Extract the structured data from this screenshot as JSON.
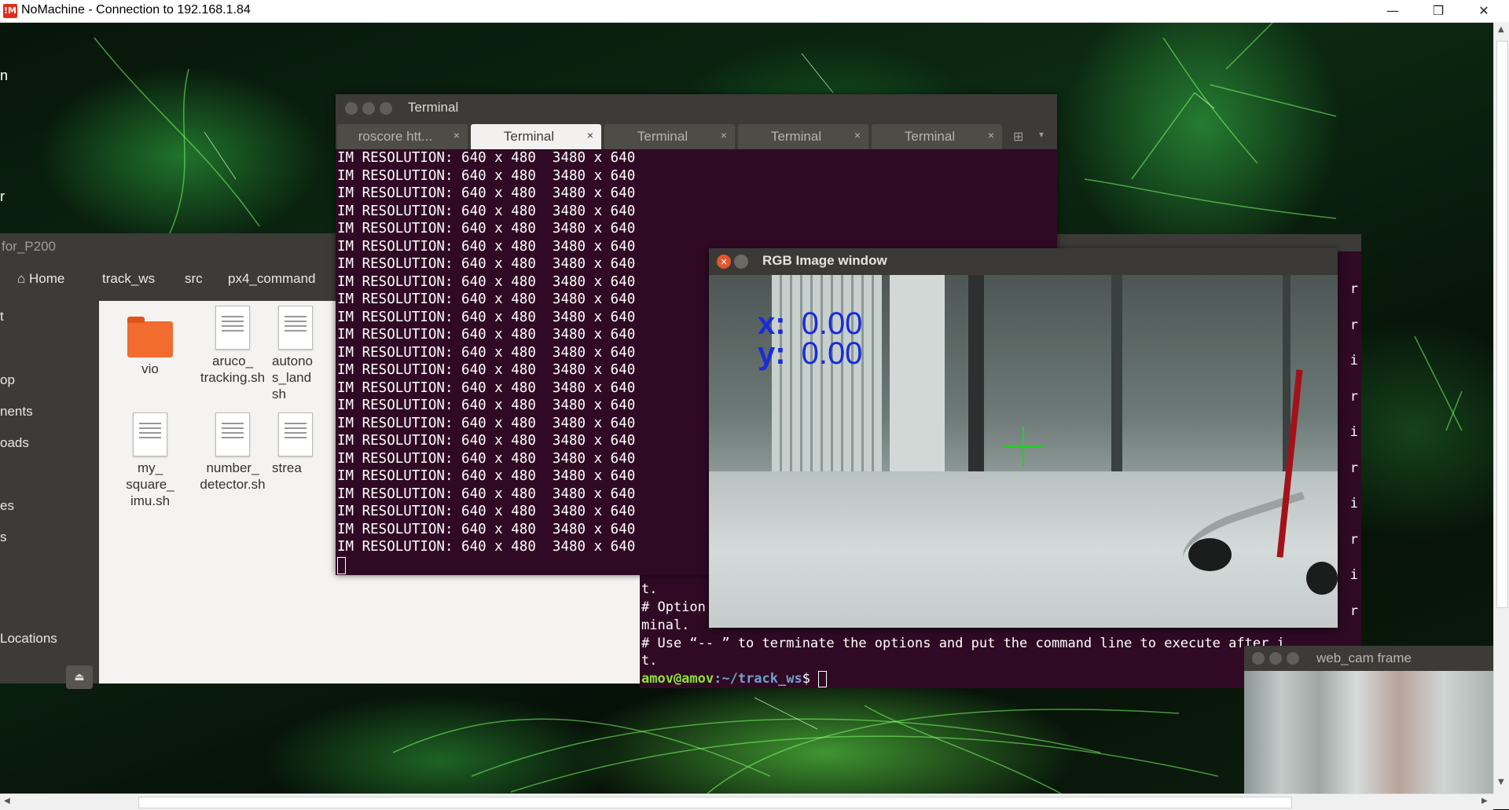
{
  "host_window": {
    "title": "NoMachine - Connection to 192.168.1.84",
    "logo_text": "!M",
    "minimize": "—",
    "maximize": "❐",
    "close": "✕"
  },
  "left_strip": {
    "items": [
      "n",
      "r",
      "t",
      "op",
      "nents",
      "oads",
      "es",
      "s",
      "Locations"
    ]
  },
  "file_manager": {
    "title": "for_P200",
    "breadcrumbs": [
      "Home",
      "track_ws",
      "src",
      "px4_command"
    ],
    "files": [
      {
        "name": "vio",
        "icon": "folder-icon"
      },
      {
        "name": "aruco_\ntracking.sh",
        "icon": "script-icon"
      },
      {
        "name": "autono\ns_land\nsh",
        "icon": "script-icon"
      },
      {
        "name": "my_\nsquare_\nimu.sh",
        "icon": "script-icon"
      },
      {
        "name": "number_\ndetector.sh",
        "icon": "script-icon"
      },
      {
        "name": "strea",
        "icon": "script-icon"
      }
    ],
    "eject_icon": "⏏"
  },
  "terminal_main": {
    "title": "Terminal",
    "tabs": [
      {
        "label": "roscore htt...",
        "active": false
      },
      {
        "label": "Terminal",
        "active": true
      },
      {
        "label": "Terminal",
        "active": false
      },
      {
        "label": "Terminal",
        "active": false
      },
      {
        "label": "Terminal",
        "active": false
      }
    ],
    "tab_close": "×",
    "lines": [
      "IM RESOLUTION: 640 x 480  3480 x 640",
      "IM RESOLUTION: 640 x 480  3480 x 640",
      "IM RESOLUTION: 640 x 480  3480 x 640",
      "IM RESOLUTION: 640 x 480  3480 x 640",
      "IM RESOLUTION: 640 x 480  3480 x 640",
      "IM RESOLUTION: 640 x 480  3480 x 640",
      "IM RESOLUTION: 640 x 480  3480 x 640",
      "IM RESOLUTION: 640 x 480  3480 x 640",
      "IM RESOLUTION: 640 x 480  3480 x 640",
      "IM RESOLUTION: 640 x 480  3480 x 640",
      "IM RESOLUTION: 640 x 480  3480 x 640",
      "IM RESOLUTION: 640 x 480  3480 x 640",
      "IM RESOLUTION: 640 x 480  3480 x 640",
      "IM RESOLUTION: 640 x 480  3480 x 640",
      "IM RESOLUTION: 640 x 480  3480 x 640",
      "IM RESOLUTION: 640 x 480  3480 x 640",
      "IM RESOLUTION: 640 x 480  3480 x 640",
      "IM RESOLUTION: 640 x 480  3480 x 640",
      "IM RESOLUTION: 640 x 480  3480 x 640",
      "IM RESOLUTION: 640 x 480  3480 x 640",
      "IM RESOLUTION: 640 x 480  3480 x 640",
      "IM RESOLUTION: 640 x 480  3480 x 640",
      "IM RESOLUTION: 640 x 480  3480 x 640"
    ]
  },
  "terminal_back": {
    "lines": [
      "# Use",
      "t.",
      "# Option",
      "minal.",
      "# Use “-- ” to terminate the options and put the command line to execute after i",
      "t."
    ],
    "prompt_user": "amov@amov",
    "prompt_path": ":~/track_ws",
    "prompt_symbol": "$ ",
    "edge_chars": [
      "r",
      "r",
      "i",
      "r",
      "i",
      "r",
      "i",
      "r",
      "i",
      "r"
    ]
  },
  "rgb_window": {
    "title": "RGB Image window",
    "x_label": "x:",
    "x_value": "0.00",
    "y_label": "y:",
    "y_value": "0.00"
  },
  "webcam_window": {
    "title": "web_cam frame"
  },
  "scrollbars": {
    "up": "▲",
    "down": "▼",
    "left": "◀",
    "right": "▶"
  }
}
